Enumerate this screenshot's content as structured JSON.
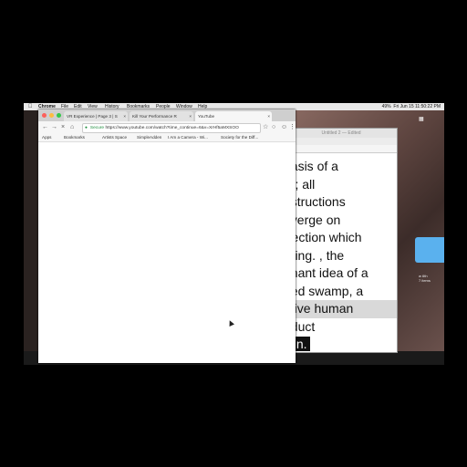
{
  "menubar": {
    "apple": "",
    "items": [
      "Chrome",
      "File",
      "Edit",
      "View",
      "History",
      "Bookmarks",
      "People",
      "Window",
      "Help"
    ],
    "status": "Fri Jun 15 11:50:22 PM",
    "battery": "49%"
  },
  "chrome": {
    "tabs": [
      {
        "label": "VR Experience | Page 3 | S"
      },
      {
        "label": "Kill Your Performance R"
      },
      {
        "label": "YouTube"
      }
    ],
    "url_secure": "Secure",
    "url": "https://www.youtube.com/watch?time_continue=6&v=XrHf5aMXSOO",
    "bookmarks": [
      "Apps",
      "Bookmarks",
      "Artists Space",
      "SimpleAdden",
      "I Am a Camera - Wi...",
      "Society for the Diff..."
    ]
  },
  "document": {
    "title": "Untitled 2 — Edited",
    "lines": [
      "basis of a",
      "rd; all",
      "nstructions",
      "nverge on",
      "rfection which",
      "oring. , the",
      "gnant idea of a",
      "ded swamp, a",
      "ative human",
      "oduct",
      "ain."
    ]
  },
  "desktop": {
    "folder_label": "w 6th\n7 items"
  },
  "colors": {
    "close": "#fc605b",
    "minimize": "#fdbc40",
    "zoom": "#34c84a",
    "folder": "#5ab1ee"
  }
}
